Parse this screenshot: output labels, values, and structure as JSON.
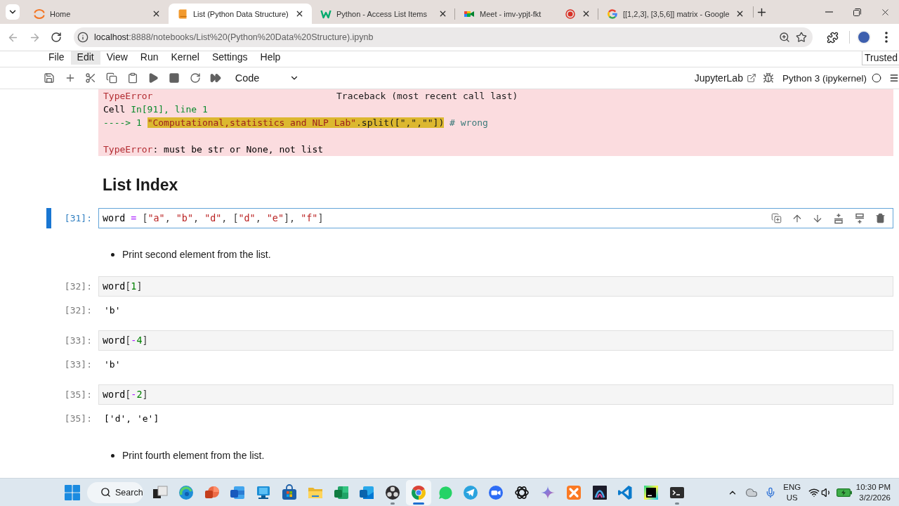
{
  "browser": {
    "tabs": [
      {
        "title": "Home",
        "kind": "arcs",
        "selected": false,
        "recording": false
      },
      {
        "title": "List (Python Data Structure)",
        "kind": "book",
        "selected": true,
        "recording": false
      },
      {
        "title": "Python - Access List Items",
        "kind": "zigzag",
        "selected": false,
        "recording": false
      },
      {
        "title": "Meet - imv-ypjt-fkt",
        "kind": "camera",
        "selected": false,
        "recording": true
      },
      {
        "title": "[[1,2,3], [3,5,6]] matrix - Google",
        "kind": "ring",
        "selected": false,
        "recording": false
      }
    ],
    "back_disabled": true,
    "forward_disabled": true,
    "address": {
      "host": "localhost",
      "path": ":8888/notebooks/List%20(Python%20Data%20Structure).ipynb"
    }
  },
  "menu": {
    "items": [
      {
        "label": "File",
        "selected": false
      },
      {
        "label": "Edit",
        "selected": true
      },
      {
        "label": "View",
        "selected": false
      },
      {
        "label": "Run",
        "selected": false
      },
      {
        "label": "Kernel",
        "selected": false
      },
      {
        "label": "Settings",
        "selected": false
      },
      {
        "label": "Help",
        "selected": false
      }
    ],
    "trust": "Trusted"
  },
  "toolbar": {
    "cell_type": "Code",
    "app_link": "JupyterLab",
    "kernel": "Python 3 (ipykernel)"
  },
  "cells": [
    {
      "kind": "error",
      "header": {
        "name": "TypeError",
        "title": "Traceback (most recent call last)"
      },
      "location": [
        {
          "text": "Cell ",
          "kind": "plain"
        },
        {
          "text": "In[91], line 1",
          "kind": "green"
        }
      ],
      "source": [
        {
          "text": "----> 1 ",
          "kind": "green"
        },
        {
          "text": "\"Computational,statistics and NLP Lab\"",
          "kind": "hl_str"
        },
        {
          "text": ".split([\",\",\"\"])",
          "kind": "hl_plain"
        },
        {
          "text": " # wrong",
          "kind": "comment"
        }
      ],
      "message": [
        {
          "text": "TypeError",
          "kind": "error"
        },
        {
          "text": ": must be str or None, not list",
          "kind": "plain"
        }
      ]
    },
    {
      "kind": "heading",
      "text": "List Index"
    },
    {
      "kind": "code",
      "prompt": "[31]:",
      "active": true,
      "source": [
        {
          "text": "word",
          "kind": "var"
        },
        {
          "text": " = ",
          "kind": "op"
        },
        {
          "text": "[",
          "kind": "punct"
        },
        {
          "text": "\"a\"",
          "kind": "str"
        },
        {
          "text": ", ",
          "kind": "punct"
        },
        {
          "text": "\"b\"",
          "kind": "str"
        },
        {
          "text": ", ",
          "kind": "punct"
        },
        {
          "text": "\"d\"",
          "kind": "str"
        },
        {
          "text": ", ",
          "kind": "punct"
        },
        {
          "text": "[",
          "kind": "punct"
        },
        {
          "text": "\"d\"",
          "kind": "str"
        },
        {
          "text": ", ",
          "kind": "punct"
        },
        {
          "text": "\"e\"",
          "kind": "str"
        },
        {
          "text": "], ",
          "kind": "punct"
        },
        {
          "text": "\"f\"",
          "kind": "str"
        },
        {
          "text": "]",
          "kind": "punct"
        }
      ]
    },
    {
      "kind": "bullet",
      "text": "Print second element from the list."
    },
    {
      "kind": "code",
      "prompt": "[32]:",
      "active": false,
      "source": [
        {
          "text": "word",
          "kind": "var"
        },
        {
          "text": "[",
          "kind": "punct"
        },
        {
          "text": "1",
          "kind": "num"
        },
        {
          "text": "]",
          "kind": "punct"
        }
      ],
      "output": {
        "prompt": "[32]:",
        "text": "'b'"
      }
    },
    {
      "kind": "code",
      "prompt": "[33]:",
      "active": false,
      "source": [
        {
          "text": "word",
          "kind": "var"
        },
        {
          "text": "[",
          "kind": "punct"
        },
        {
          "text": "-",
          "kind": "op"
        },
        {
          "text": "4",
          "kind": "num"
        },
        {
          "text": "]",
          "kind": "punct"
        }
      ],
      "output": {
        "prompt": "[33]:",
        "text": "'b'"
      }
    },
    {
      "kind": "code",
      "prompt": "[35]:",
      "active": false,
      "source": [
        {
          "text": "word",
          "kind": "var"
        },
        {
          "text": "[",
          "kind": "punct"
        },
        {
          "text": "-",
          "kind": "op"
        },
        {
          "text": "2",
          "kind": "num"
        },
        {
          "text": "]",
          "kind": "punct"
        }
      ],
      "output": {
        "prompt": "[35]:",
        "text": "['d', 'e']"
      }
    },
    {
      "kind": "bullet",
      "text": "Print fourth element from the list."
    }
  ],
  "taskbar": {
    "search": "Search",
    "apps": [
      {
        "kind": "overlap",
        "running": false,
        "selected": false
      },
      {
        "kind": "swirl",
        "running": false,
        "selected": false
      },
      {
        "kind": "pie",
        "running": false,
        "selected": false
      },
      {
        "kind": "document",
        "running": false,
        "selected": false
      },
      {
        "kind": "monitor",
        "running": false,
        "selected": false
      },
      {
        "kind": "bag",
        "running": false,
        "selected": false
      },
      {
        "kind": "folder",
        "running": false,
        "selected": false
      },
      {
        "kind": "sheet",
        "running": false,
        "selected": false
      },
      {
        "kind": "mail",
        "running": false,
        "selected": false
      },
      {
        "kind": "orbs",
        "running": true,
        "selected": false
      },
      {
        "kind": "browser",
        "running": true,
        "selected": true
      },
      {
        "kind": "chat",
        "running": false,
        "selected": false
      },
      {
        "kind": "plane",
        "running": false,
        "selected": false
      },
      {
        "kind": "camera",
        "running": false,
        "selected": false
      },
      {
        "kind": "knot",
        "running": false,
        "selected": false
      },
      {
        "kind": "sparkle",
        "running": false,
        "selected": false
      },
      {
        "kind": "cross",
        "running": false,
        "selected": false
      },
      {
        "kind": "arch",
        "running": false,
        "selected": false
      },
      {
        "kind": "ribbon",
        "running": false,
        "selected": false
      },
      {
        "kind": "square",
        "running": false,
        "selected": false
      },
      {
        "kind": "terminal",
        "running": true,
        "selected": false
      }
    ],
    "language": "ENG",
    "region": "US",
    "time": "10:30 PM",
    "date": "3/2/2026"
  }
}
